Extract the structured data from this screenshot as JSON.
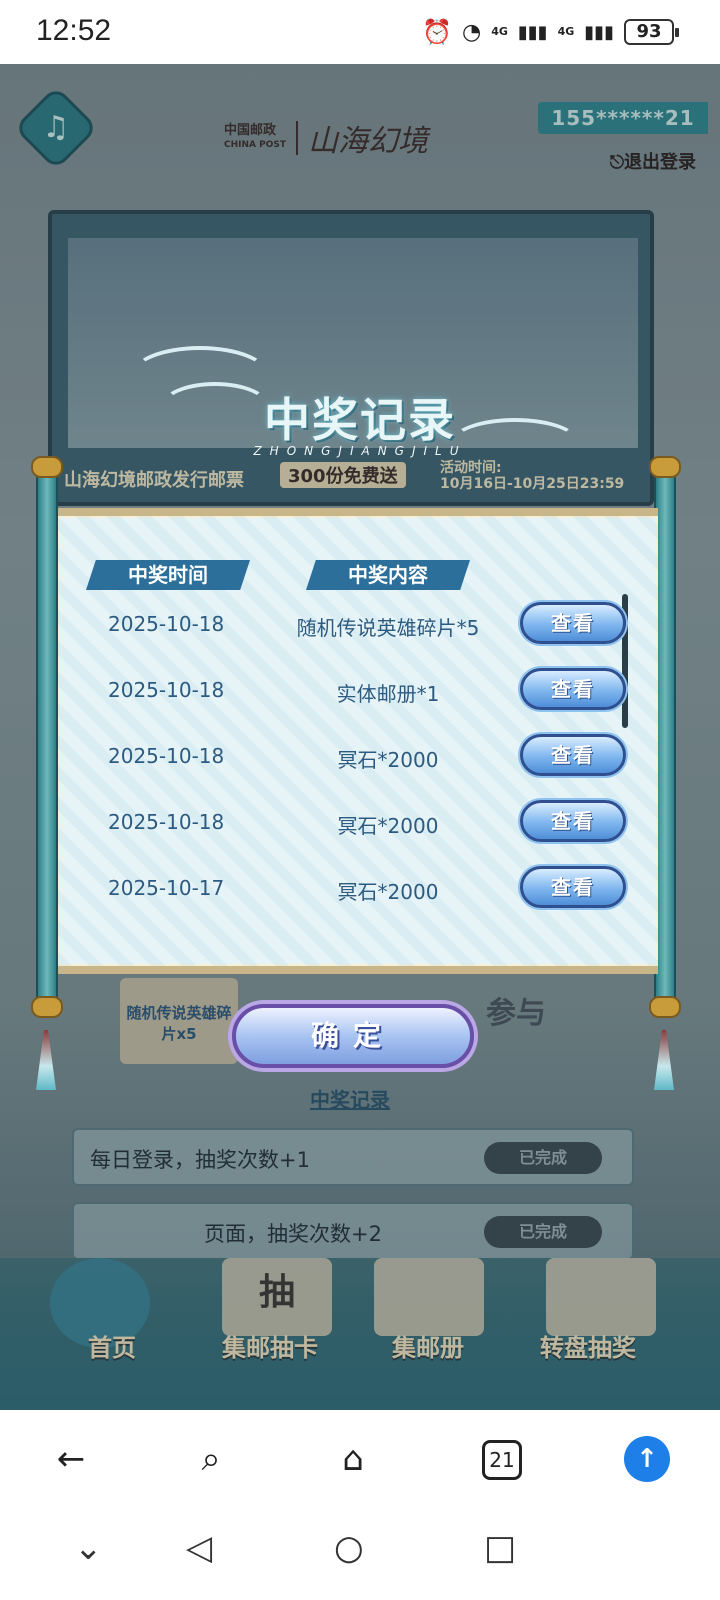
{
  "status_bar": {
    "time": "12:52",
    "signal_1": "4G",
    "signal_2": "4G",
    "battery": "93"
  },
  "header": {
    "brand_cn": "中国邮政",
    "brand_en": "CHINA POST",
    "game_logo": "山海幻境",
    "phone": "155******21",
    "logout": "退出登录"
  },
  "banner": {
    "caption": "山海幻境邮政发行邮票",
    "free": "300份免费送",
    "date_label": "活动时间:",
    "date_range": "10月16日-10月25日23:59"
  },
  "modal": {
    "title": "中奖记录",
    "subtitle": "ZHONGJIANGJILU",
    "col_time": "中奖时间",
    "col_content": "中奖内容",
    "view_label": "查看",
    "rows": [
      {
        "date": "2025-10-18",
        "content": "随机传说英雄碎片*5"
      },
      {
        "date": "2025-10-18",
        "content": "实体邮册*1"
      },
      {
        "date": "2025-10-18",
        "content": "冥石*2000"
      },
      {
        "date": "2025-10-18",
        "content": "冥石*2000"
      },
      {
        "date": "2025-10-17",
        "content": "冥石*2000"
      }
    ],
    "confirm": "确定"
  },
  "behind": {
    "prize_card": "随机传说英雄碎片x5",
    "join": "参与",
    "record_link": "中奖记录",
    "tasks": [
      {
        "label": "每日登录，抽奖次数+1",
        "status": "已完成"
      },
      {
        "label": "页面，抽奖次数+2",
        "status": "已完成"
      }
    ]
  },
  "bottom_nav": {
    "items": [
      "首页",
      "集邮抽卡",
      "集邮册",
      "转盘抽奖"
    ],
    "draw_char": "抽"
  },
  "browser": {
    "tab_count": "21"
  },
  "icons": {
    "music": "music-note-icon",
    "back": "back-arrow-icon",
    "search": "search-icon",
    "home": "home-icon",
    "upload": "upload-arrow-icon"
  },
  "colors": {
    "accent_blue": "#2c6f9a",
    "text_blue": "#2d5a80",
    "browser_upload": "#1f7fe8"
  }
}
